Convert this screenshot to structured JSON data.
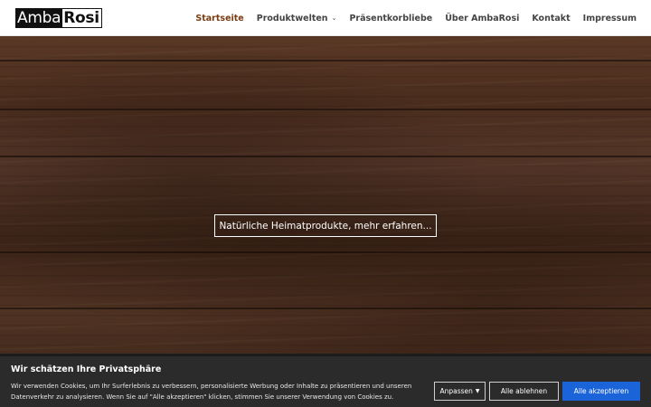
{
  "header": {
    "logo": {
      "part_a": "Amba",
      "part_b": "Rosi"
    },
    "nav": [
      {
        "label": "Startseite",
        "active": true
      },
      {
        "label": "Produktwelten",
        "has_dropdown": true
      },
      {
        "label": "Präsentkorbliebe"
      },
      {
        "label": "Über AmbaRosi"
      },
      {
        "label": "Kontakt"
      },
      {
        "label": "Impressum"
      }
    ]
  },
  "hero": {
    "cta_label": "Natürliche Heimatprodukte, mehr erfahren..."
  },
  "cookie_banner": {
    "title": "Wir schätzen Ihre Privatsphäre",
    "text": "Wir verwenden Cookies, um Ihr Surferlebnis zu verbessern, personalisierte Werbung oder Inhalte zu präsentieren und unseren Datenverkehr zu analysieren. Wenn Sie auf \"Alle akzeptieren\" klicken, stimmen Sie unserer Verwendung von Cookies zu.",
    "customize_label": "Anpassen",
    "reject_label": "Alle ablehnen",
    "accept_label": "Alle akzeptieren"
  },
  "colors": {
    "nav_active": "#7a3d12",
    "accept_button": "#1a63d8",
    "banner_bg": "#2b2b2b"
  },
  "icons": {
    "dropdown": "chevron-down-icon",
    "customize_caret": "caret-down-icon"
  }
}
